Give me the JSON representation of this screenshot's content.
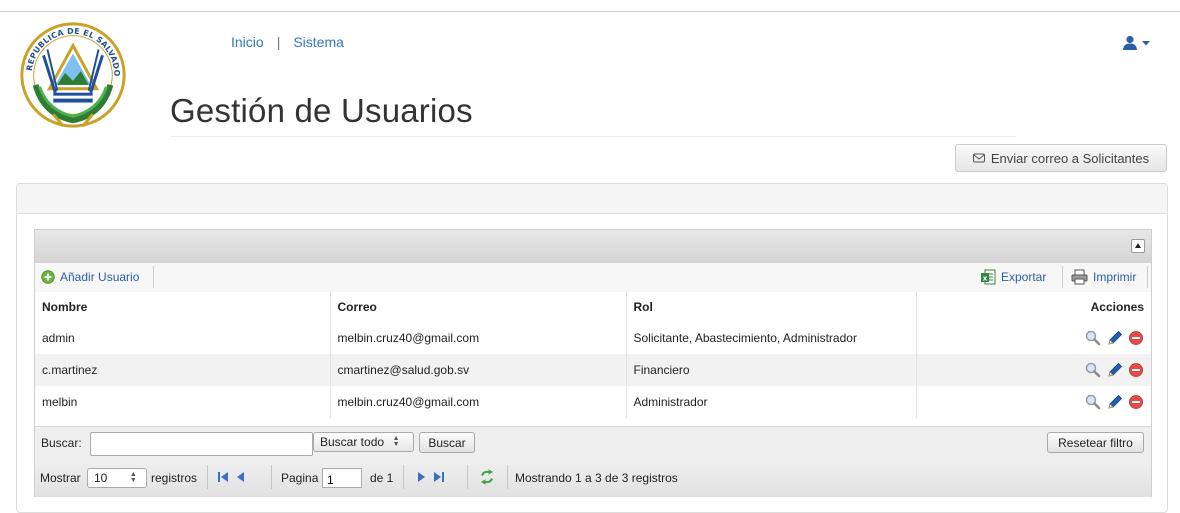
{
  "nav": {
    "home": "Inicio",
    "separator": "|",
    "system": "Sistema",
    "user_icon": "user-icon"
  },
  "logo": {
    "seal_text": "REPUBLICA DE EL SALVADOR EN LA AMERICA CENTRAL",
    "icon": "coat-of-arms"
  },
  "page": {
    "title": "Gestión de Usuarios",
    "email_button": "Enviar correo a Solicitantes"
  },
  "toolbar": {
    "add_user": "Añadir Usuario",
    "export": "Exportar",
    "print": "Imprimir"
  },
  "table": {
    "columns": [
      "Nombre",
      "Correo",
      "Rol",
      "Acciones"
    ],
    "rows": [
      {
        "nombre": "admin",
        "correo": "melbin.cruz40@gmail.com",
        "rol": "Solicitante, Abastecimiento, Administrador"
      },
      {
        "nombre": "c.martinez",
        "correo": "cmartinez@salud.gob.sv",
        "rol": "Financiero"
      },
      {
        "nombre": "melbin",
        "correo": "melbin.cruz40@gmail.com",
        "rol": "Administrador"
      }
    ],
    "action_icons": [
      "search-icon",
      "edit-pencil-icon",
      "delete-icon"
    ]
  },
  "search": {
    "label": "Buscar:",
    "value": "",
    "scope": "Buscar todo",
    "button": "Buscar",
    "reset": "Resetear filtro"
  },
  "pager": {
    "show_label": "Mostrar",
    "page_size": "10",
    "records_label": "registros",
    "page_label": "Pagina",
    "page_value": "1",
    "of_label": "de 1",
    "status": "Mostrando 1 a 3 de 3 registros"
  },
  "colors": {
    "link": "#337ab7",
    "toolbar_link": "#2a5ea8",
    "delete": "#e84a4a",
    "edit": "#1f5fb5",
    "refresh": "#3aa23a"
  }
}
